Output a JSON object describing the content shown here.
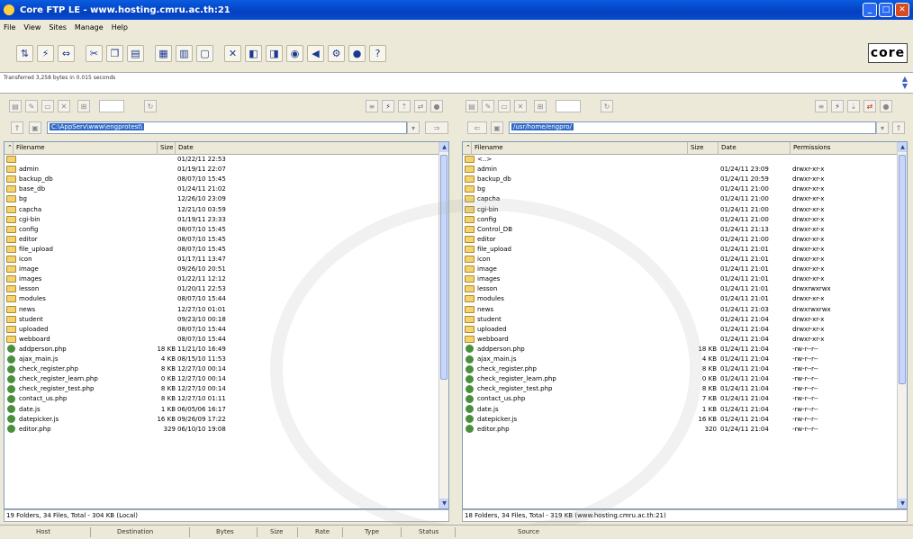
{
  "title": "Core FTP LE - www.hosting.cmru.ac.th:21",
  "menu": [
    "File",
    "View",
    "Sites",
    "Manage",
    "Help"
  ],
  "window_controls": [
    "minimize-icon",
    "maximize-icon",
    "close-icon"
  ],
  "toolbar_icons": [
    "connect-icon",
    "quick-connect-icon",
    "disconnect-icon",
    "cut-icon",
    "copy-icon",
    "paste-icon",
    "view-icon",
    "edit-icon",
    "properties-icon",
    "tools-icon",
    "site-manager-icon",
    "queue-icon",
    "preview-icon",
    "sound-icon",
    "settings-icon",
    "about-icon",
    "help-icon"
  ],
  "logo": "core",
  "log": {
    "message": "Transferred 3,258 bytes in 0.015 seconds"
  },
  "columns": {
    "filename": "Filename",
    "size": "Size",
    "date": "Date",
    "permissions": "Permissions"
  },
  "local": {
    "path": "C:\\AppServ\\www\\engprotest\\",
    "status": "19 Folders, 34 Files, Total - 304 KB (Local)",
    "rows": [
      {
        "name": "",
        "size": "",
        "date": "01/22/11  22:53",
        "folder": true
      },
      {
        "name": "admin",
        "size": "",
        "date": "01/19/11  22:07",
        "folder": true
      },
      {
        "name": "backup_db",
        "size": "",
        "date": "08/07/10  15:45",
        "folder": true
      },
      {
        "name": "base_db",
        "size": "",
        "date": "01/24/11  21:02",
        "folder": true
      },
      {
        "name": "bg",
        "size": "",
        "date": "12/26/10  23:09",
        "folder": true
      },
      {
        "name": "capcha",
        "size": "",
        "date": "12/21/10  03:59",
        "folder": true
      },
      {
        "name": "cgi-bin",
        "size": "",
        "date": "01/19/11  23:33",
        "folder": true
      },
      {
        "name": "config",
        "size": "",
        "date": "08/07/10  15:45",
        "folder": true
      },
      {
        "name": "editor",
        "size": "",
        "date": "08/07/10  15:45",
        "folder": true
      },
      {
        "name": "file_upload",
        "size": "",
        "date": "08/07/10  15:45",
        "folder": true
      },
      {
        "name": "icon",
        "size": "",
        "date": "01/17/11  13:47",
        "folder": true
      },
      {
        "name": "image",
        "size": "",
        "date": "09/26/10  20:51",
        "folder": true
      },
      {
        "name": "images",
        "size": "",
        "date": "01/22/11  12:12",
        "folder": true
      },
      {
        "name": "lesson",
        "size": "",
        "date": "01/20/11  22:53",
        "folder": true
      },
      {
        "name": "modules",
        "size": "",
        "date": "08/07/10  15:44",
        "folder": true
      },
      {
        "name": "news",
        "size": "",
        "date": "12/27/10  01:01",
        "folder": true
      },
      {
        "name": "student",
        "size": "",
        "date": "09/23/10  00:18",
        "folder": true
      },
      {
        "name": "uploaded",
        "size": "",
        "date": "08/07/10  15:44",
        "folder": true
      },
      {
        "name": "webboard",
        "size": "",
        "date": "08/07/10  15:44",
        "folder": true
      },
      {
        "name": "addperson.php",
        "size": "18 KB",
        "date": "11/21/10  16:49",
        "folder": false
      },
      {
        "name": "ajax_main.js",
        "size": "4 KB",
        "date": "08/15/10  11:53",
        "folder": false
      },
      {
        "name": "check_register.php",
        "size": "8 KB",
        "date": "12/27/10  00:14",
        "folder": false
      },
      {
        "name": "check_register_learn.php",
        "size": "0 KB",
        "date": "12/27/10  00:14",
        "folder": false
      },
      {
        "name": "check_register_test.php",
        "size": "8 KB",
        "date": "12/27/10  00:14",
        "folder": false
      },
      {
        "name": "contact_us.php",
        "size": "8 KB",
        "date": "12/27/10  01:11",
        "folder": false
      },
      {
        "name": "date.js",
        "size": "1 KB",
        "date": "06/05/06  16:17",
        "folder": false
      },
      {
        "name": "datepicker.js",
        "size": "16 KB",
        "date": "09/26/09  17:22",
        "folder": false
      },
      {
        "name": "editor.php",
        "size": "329",
        "date": "06/10/10  19:08",
        "folder": false
      }
    ]
  },
  "remote": {
    "path": "/usr/home/engpro/",
    "status": "18 Folders, 34 Files, Total - 319 KB  (www.hosting.cmru.ac.th:21)",
    "rows": [
      {
        "name": "<..>",
        "size": "",
        "date": "",
        "perm": "",
        "folder": true
      },
      {
        "name": "admin",
        "size": "",
        "date": "01/24/11  23:09",
        "perm": "drwxr-xr-x",
        "folder": true
      },
      {
        "name": "backup_db",
        "size": "",
        "date": "01/24/11  20:59",
        "perm": "drwxr-xr-x",
        "folder": true
      },
      {
        "name": "bg",
        "size": "",
        "date": "01/24/11  21:00",
        "perm": "drwxr-xr-x",
        "folder": true
      },
      {
        "name": "capcha",
        "size": "",
        "date": "01/24/11  21:00",
        "perm": "drwxr-xr-x",
        "folder": true
      },
      {
        "name": "cgi-bin",
        "size": "",
        "date": "01/24/11  21:00",
        "perm": "drwxr-xr-x",
        "folder": true
      },
      {
        "name": "config",
        "size": "",
        "date": "01/24/11  21:00",
        "perm": "drwxr-xr-x",
        "folder": true
      },
      {
        "name": "Control_DB",
        "size": "",
        "date": "01/24/11  21:13",
        "perm": "drwxr-xr-x",
        "folder": true
      },
      {
        "name": "editor",
        "size": "",
        "date": "01/24/11  21:00",
        "perm": "drwxr-xr-x",
        "folder": true
      },
      {
        "name": "file_upload",
        "size": "",
        "date": "01/24/11  21:01",
        "perm": "drwxr-xr-x",
        "folder": true
      },
      {
        "name": "icon",
        "size": "",
        "date": "01/24/11  21:01",
        "perm": "drwxr-xr-x",
        "folder": true
      },
      {
        "name": "image",
        "size": "",
        "date": "01/24/11  21:01",
        "perm": "drwxr-xr-x",
        "folder": true
      },
      {
        "name": "images",
        "size": "",
        "date": "01/24/11  21:01",
        "perm": "drwxr-xr-x",
        "folder": true
      },
      {
        "name": "lesson",
        "size": "",
        "date": "01/24/11  21:01",
        "perm": "drwxrwxrwx",
        "folder": true
      },
      {
        "name": "modules",
        "size": "",
        "date": "01/24/11  21:01",
        "perm": "drwxr-xr-x",
        "folder": true
      },
      {
        "name": "news",
        "size": "",
        "date": "01/24/11  21:03",
        "perm": "drwxrwxrwx",
        "folder": true
      },
      {
        "name": "student",
        "size": "",
        "date": "01/24/11  21:04",
        "perm": "drwxr-xr-x",
        "folder": true
      },
      {
        "name": "uploaded",
        "size": "",
        "date": "01/24/11  21:04",
        "perm": "drwxr-xr-x",
        "folder": true
      },
      {
        "name": "webboard",
        "size": "",
        "date": "01/24/11  21:04",
        "perm": "drwxr-xr-x",
        "folder": true
      },
      {
        "name": "addperson.php",
        "size": "18 KB",
        "date": "01/24/11  21:04",
        "perm": "-rw-r--r--",
        "folder": false
      },
      {
        "name": "ajax_main.js",
        "size": "4 KB",
        "date": "01/24/11  21:04",
        "perm": "-rw-r--r--",
        "folder": false
      },
      {
        "name": "check_register.php",
        "size": "8 KB",
        "date": "01/24/11  21:04",
        "perm": "-rw-r--r--",
        "folder": false
      },
      {
        "name": "check_register_learn.php",
        "size": "0 KB",
        "date": "01/24/11  21:04",
        "perm": "-rw-r--r--",
        "folder": false
      },
      {
        "name": "check_register_test.php",
        "size": "8 KB",
        "date": "01/24/11  21:04",
        "perm": "-rw-r--r--",
        "folder": false
      },
      {
        "name": "contact_us.php",
        "size": "7 KB",
        "date": "01/24/11  21:04",
        "perm": "-rw-r--r--",
        "folder": false
      },
      {
        "name": "date.js",
        "size": "1 KB",
        "date": "01/24/11  21:04",
        "perm": "-rw-r--r--",
        "folder": false
      },
      {
        "name": "datepicker.js",
        "size": "16 KB",
        "date": "01/24/11  21:04",
        "perm": "-rw-r--r--",
        "folder": false
      },
      {
        "name": "editor.php",
        "size": "320",
        "date": "01/24/11  21:04",
        "perm": "-rw-r--r--",
        "folder": false
      }
    ]
  },
  "queue_headers": [
    "Host",
    "Destination",
    "Bytes",
    "Size",
    "Rate",
    "Type",
    "Status",
    "Source"
  ]
}
